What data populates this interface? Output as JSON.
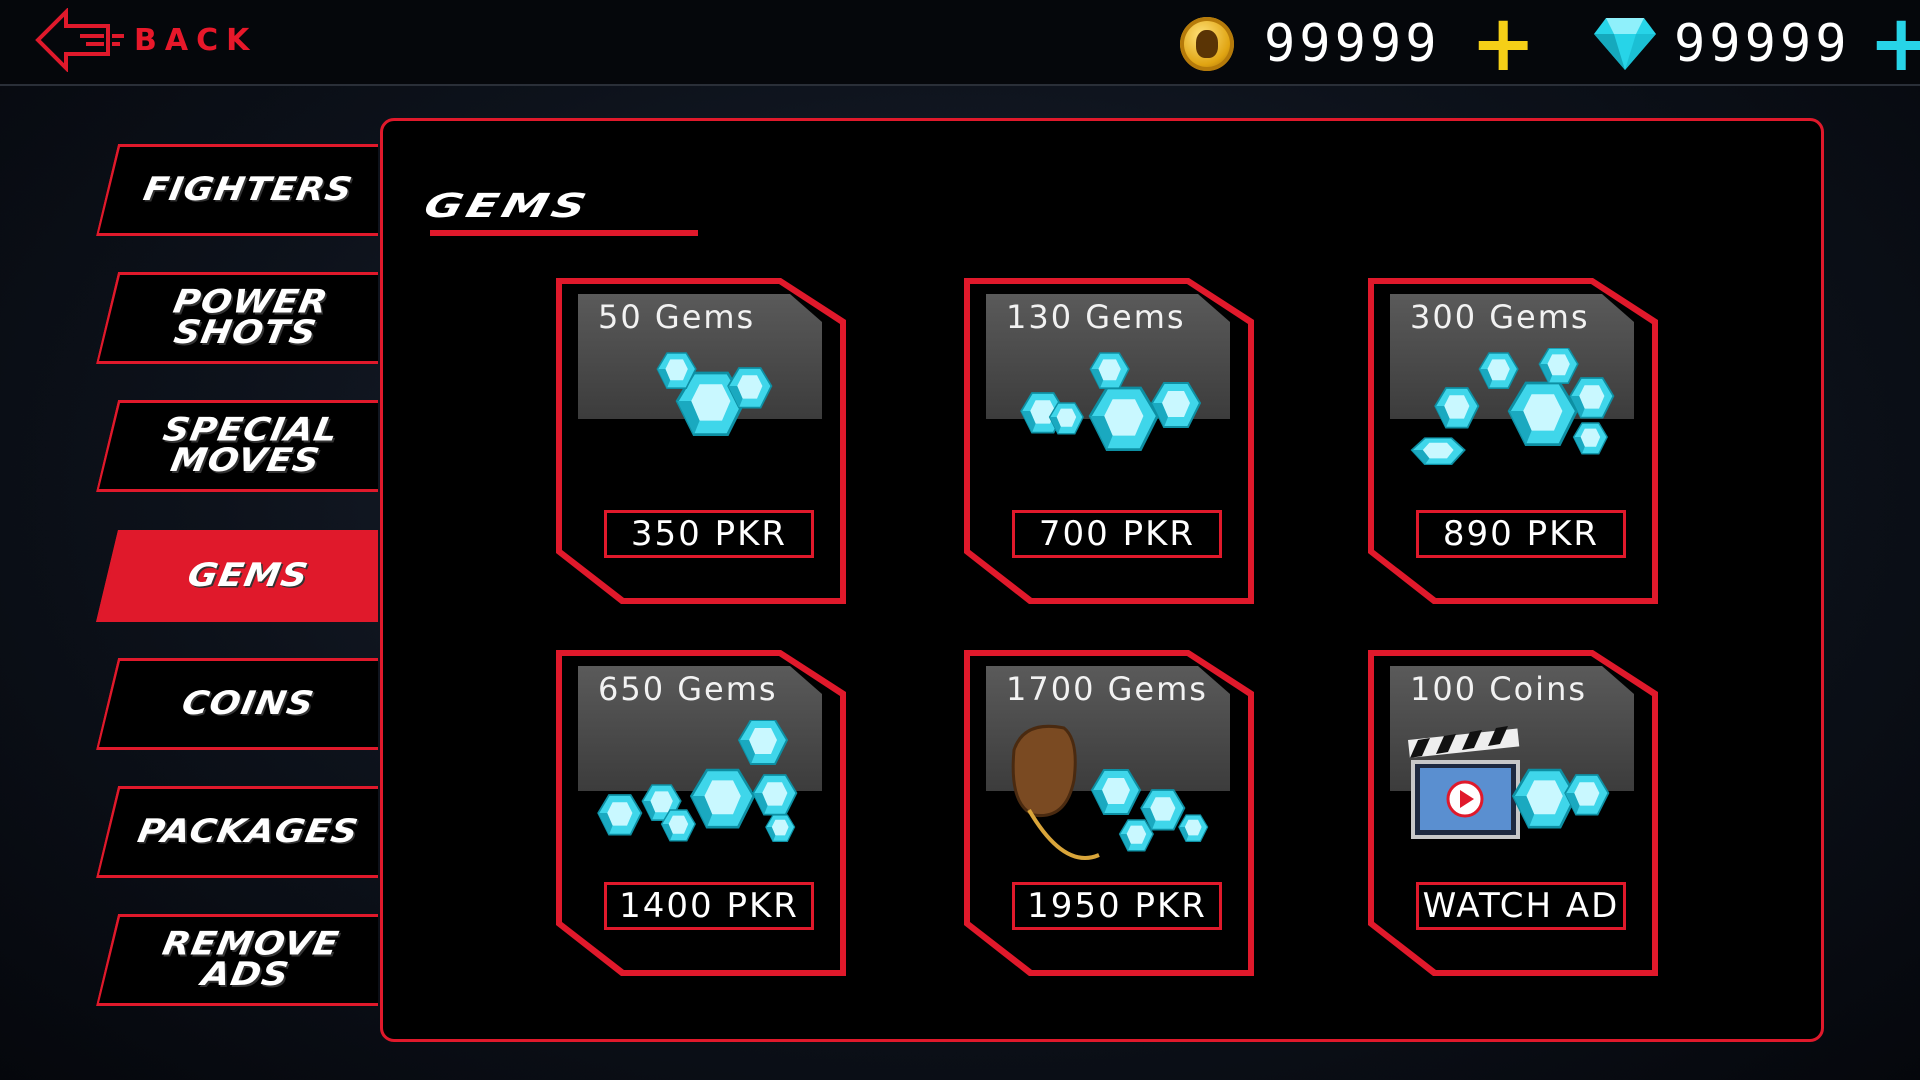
{
  "topbar": {
    "back_label": "BACK",
    "coins_value": "99999",
    "gems_value": "99999",
    "coin_icon": "coin-icon",
    "gem_icon": "diamond-icon",
    "add_coins_icon": "plus-icon",
    "add_gems_icon": "plus-icon"
  },
  "sidebar": {
    "tabs": [
      {
        "label": "FIGHTERS"
      },
      {
        "label": "POWER\nSHOTS"
      },
      {
        "label": "SPECIAL\nMOVES"
      },
      {
        "label": "GEMS",
        "active": true
      },
      {
        "label": "COINS"
      },
      {
        "label": "PACKAGES"
      },
      {
        "label": "REMOVE\nADS"
      }
    ]
  },
  "main": {
    "section_title": "GEMS",
    "cards": [
      {
        "title": "50 Gems",
        "price": "350 PKR",
        "art": "gem-small-icon"
      },
      {
        "title": "130 Gems",
        "price": "700 PKR",
        "art": "gem-pile-icon"
      },
      {
        "title": "300 Gems",
        "price": "890 PKR",
        "art": "gem-pile-large-icon"
      },
      {
        "title": "650 Gems",
        "price": "1400 PKR",
        "art": "gem-heap-icon"
      },
      {
        "title": "1700 Gems",
        "price": "1950 PKR",
        "art": "gem-sack-icon"
      },
      {
        "title": "100 Coins",
        "price": "WATCH AD",
        "art": "video-clapper-icon"
      }
    ]
  },
  "colors": {
    "accent_red": "#e0192b",
    "gem_cyan": "#27d4e8",
    "coin_gold": "#f5cf17"
  }
}
